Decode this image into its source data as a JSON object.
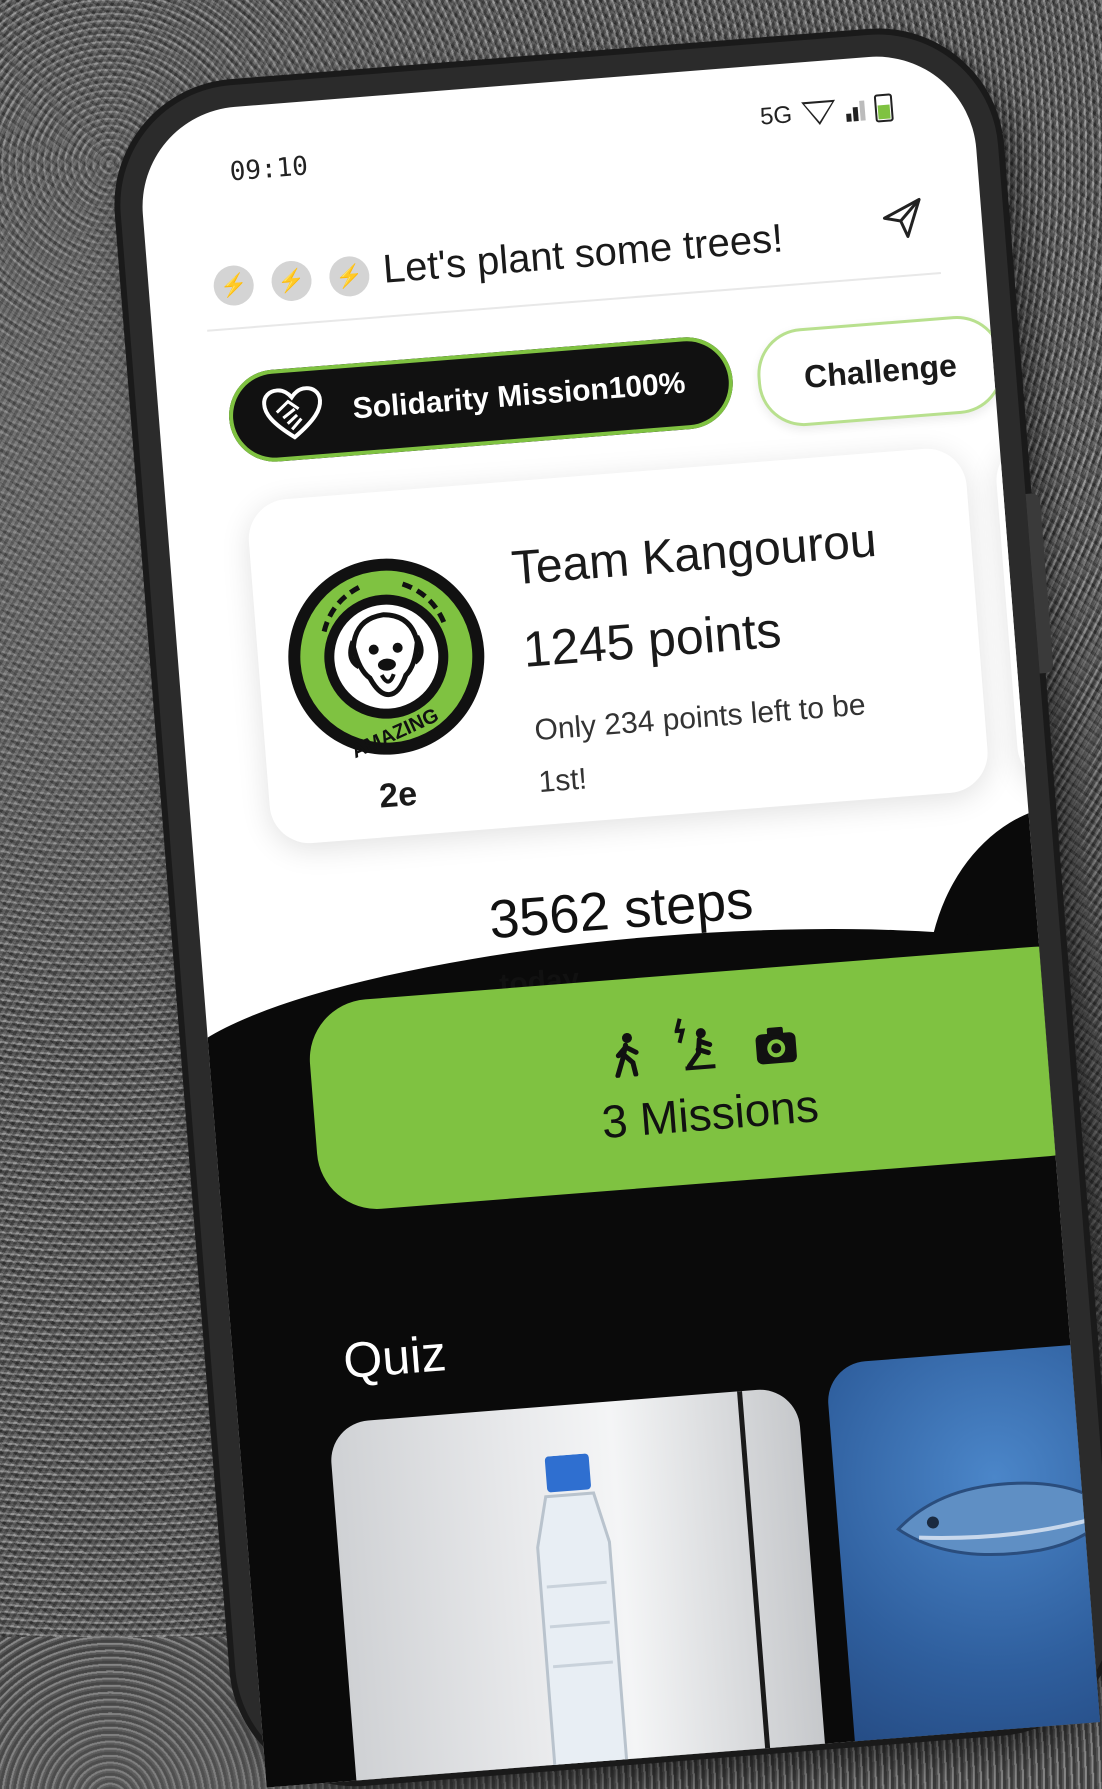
{
  "status_bar": {
    "time": "09:10",
    "network": "5G",
    "icons": [
      "wifi-icon",
      "signal-icon",
      "battery-icon"
    ]
  },
  "header": {
    "bolt_icons": [
      "bolt-icon",
      "bolt-icon",
      "bolt-icon"
    ],
    "title": "Let's plant some trees!",
    "send_icon": "send-icon"
  },
  "mission_pill": {
    "icon": "heart-handshake-icon",
    "label": "Solidarity Mission100%"
  },
  "challenge_button": {
    "label": "Challenge"
  },
  "team_card": {
    "badge_text": "AMAZING",
    "rank": "2e",
    "team_name": "Team Kangourou",
    "points": "1245 points",
    "note": "Only 234 points left to be 1st!"
  },
  "steps": {
    "count": "3562 steps",
    "period": "today"
  },
  "missions_card": {
    "icons": [
      "walk-icon",
      "scooter-icon",
      "camera-icon"
    ],
    "label": "3 Missions"
  },
  "quiz": {
    "title": "Quiz"
  },
  "colors": {
    "accent": "#7fc241",
    "dark": "#0a0a0a",
    "surface": "#ffffff"
  }
}
